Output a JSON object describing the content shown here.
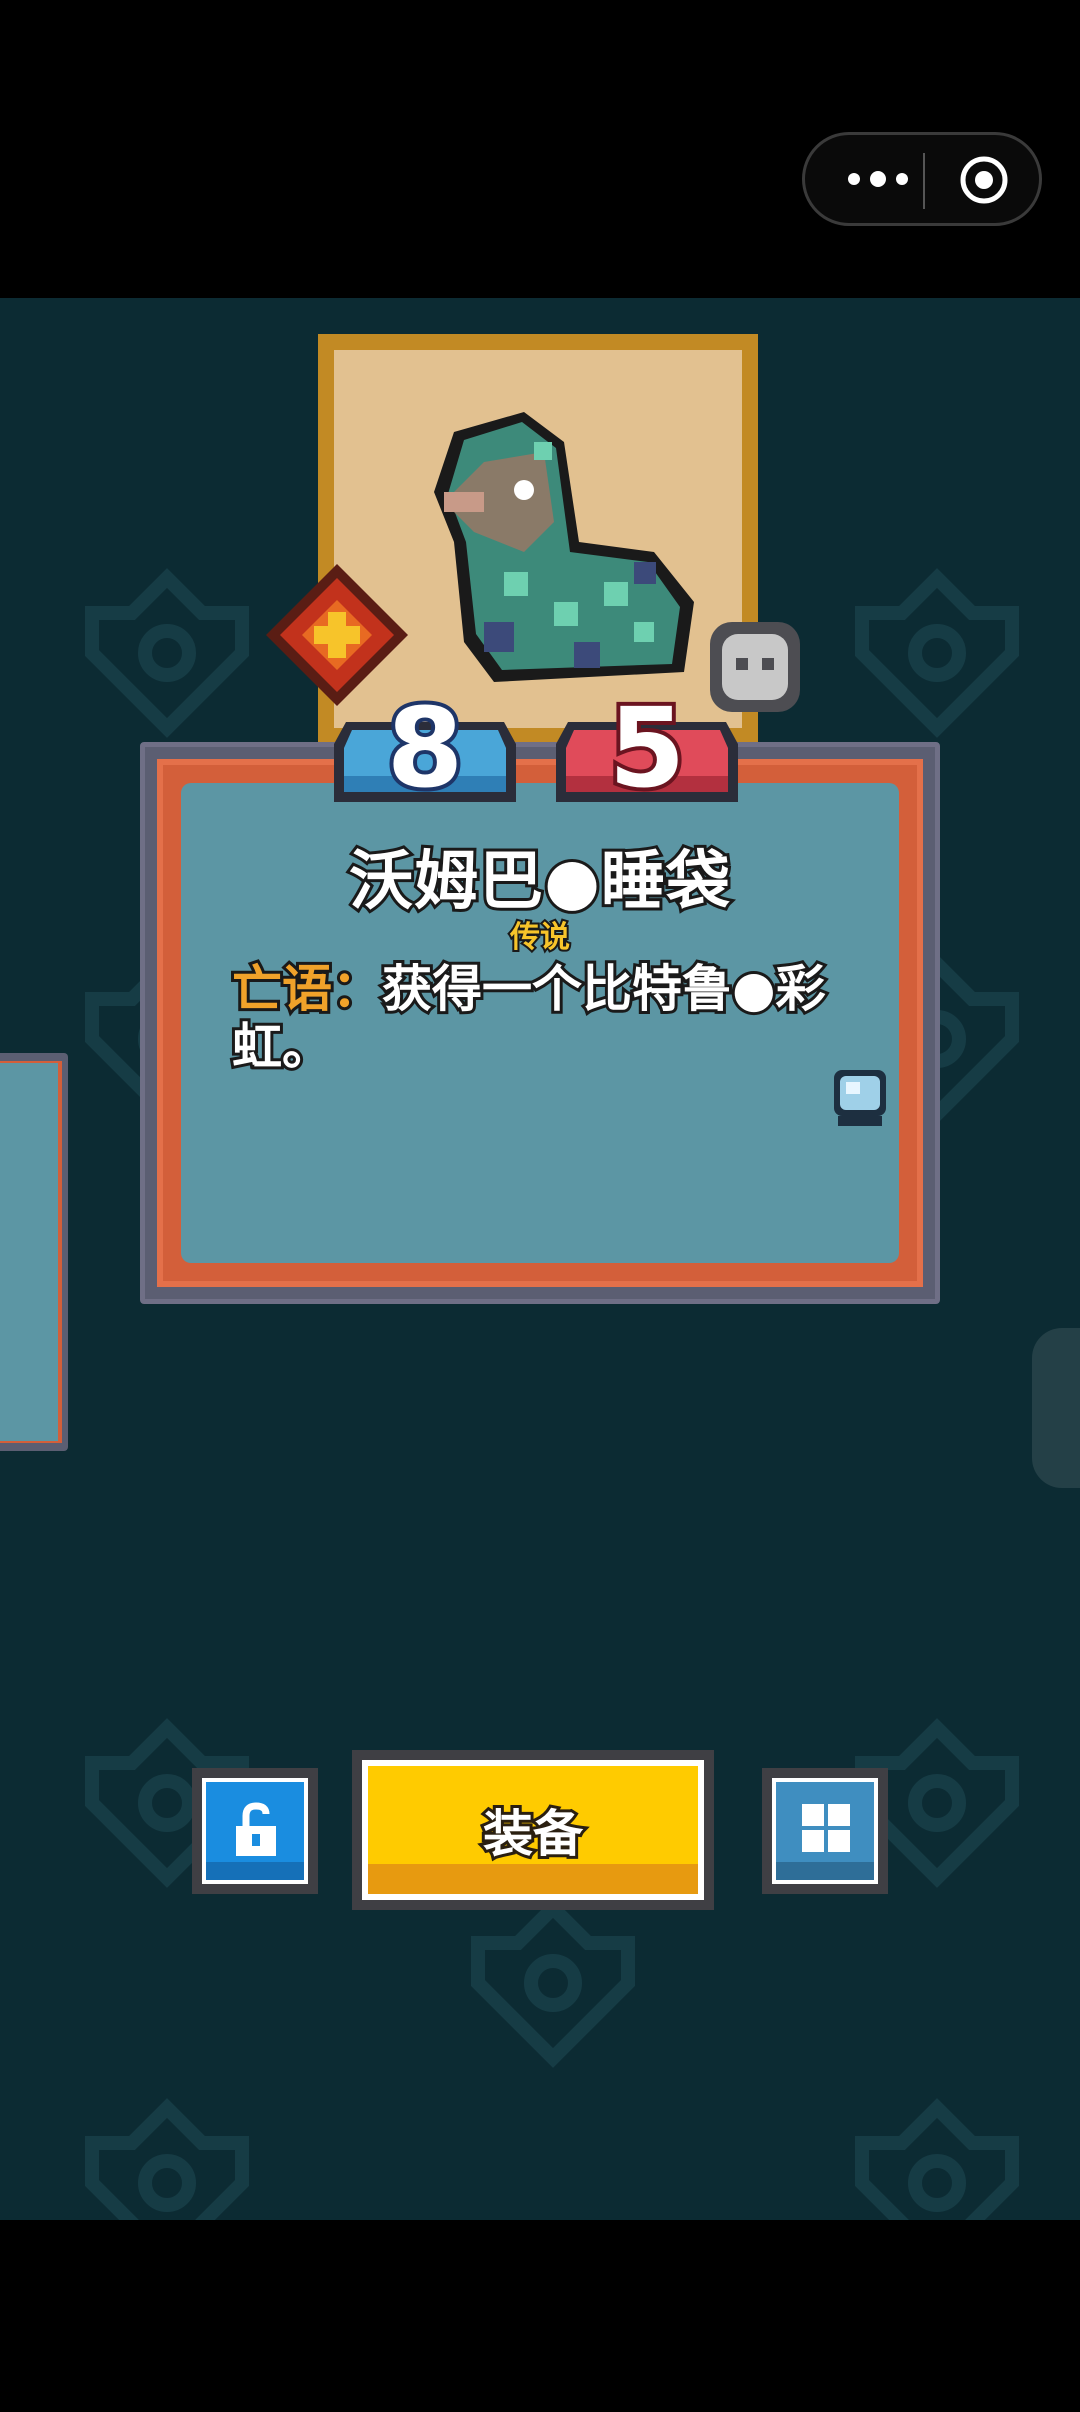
{
  "window": {
    "menu_icon": "more-dots-icon",
    "close_icon": "target-circle-icon"
  },
  "card": {
    "name": "沃姆巴●睡袋",
    "rarity": "传说",
    "ability_keyword": "亡语：",
    "ability_text": "获得一个比特鲁●彩虹。",
    "attack": "8",
    "health": "5",
    "tier_icon": "square-frame-icon",
    "tribe_icon": "red-diamond-gem-icon",
    "tag_icon": "skull-icon",
    "card_type_icon": "crystal-ball-icon"
  },
  "buttons": {
    "lock_icon": "unlock-padlock-icon",
    "equip_label": "装备",
    "grid_icon": "grid-icon"
  },
  "colors": {
    "background": "#0c2b33",
    "card_face": "#5c96a4",
    "card_border": "#d35f3a",
    "attack": "#4aa6d8",
    "health": "#e04b5a",
    "equip_button": "#ffcb00",
    "rarity_text": "#f7c42a"
  }
}
